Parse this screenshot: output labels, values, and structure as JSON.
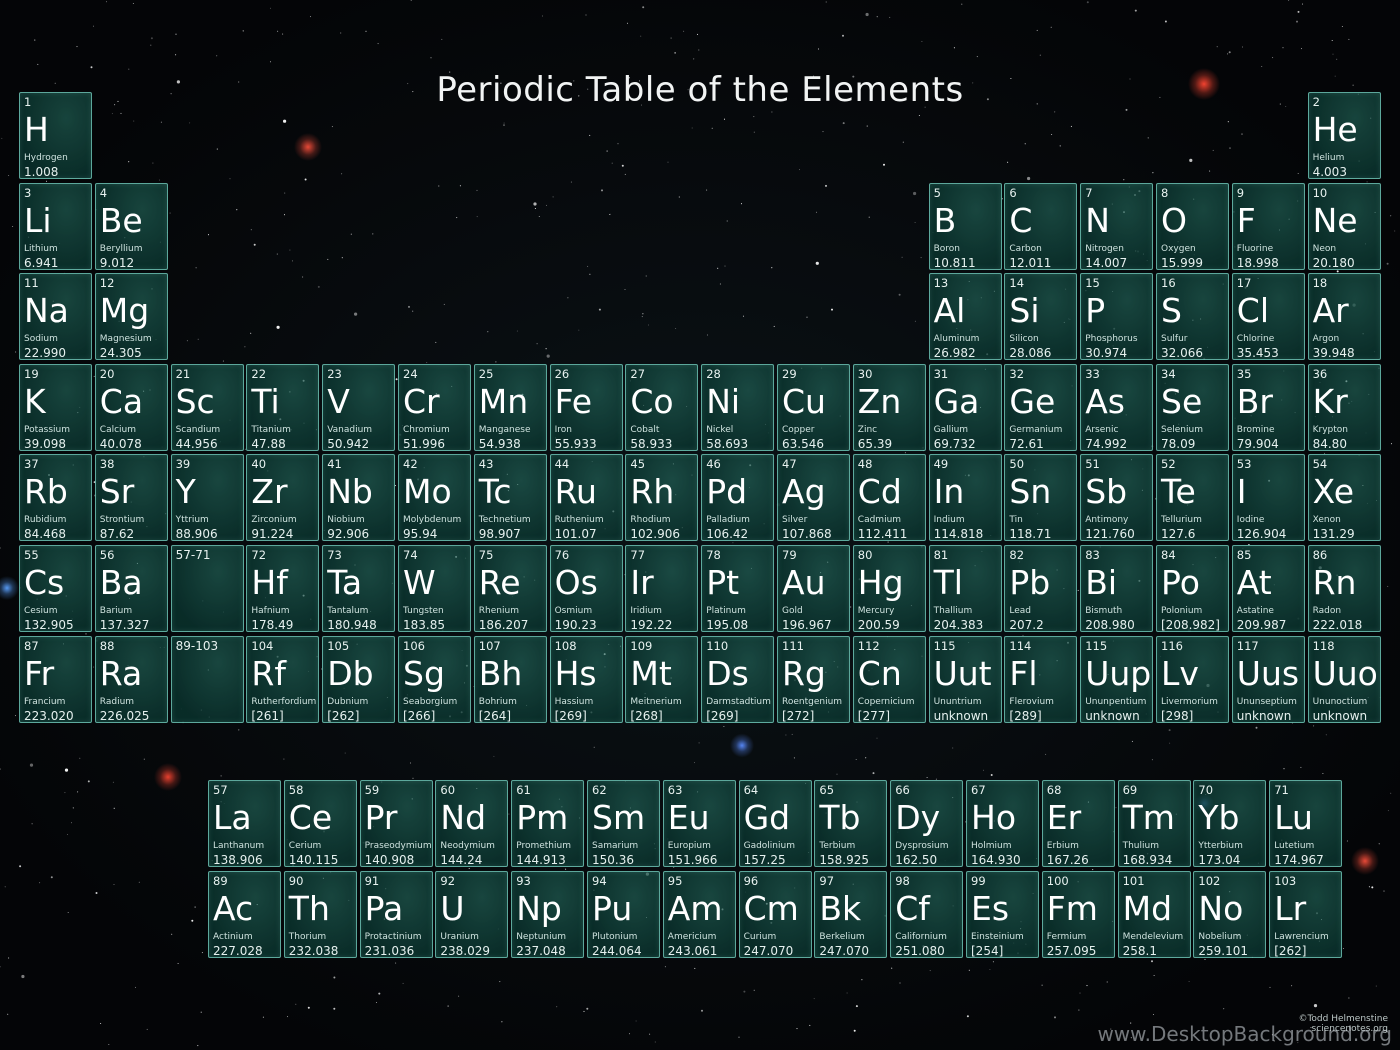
{
  "title": "Periodic Table of the Elements",
  "credit_line1": "©Todd Helmenstine",
  "credit_line2": "sciencenotes.org",
  "watermark": "www.DesktopBackground.org",
  "main_table": [
    [
      "1",
      "H",
      "Hydrogen",
      "1.008"
    ],
    null,
    null,
    null,
    null,
    null,
    null,
    null,
    null,
    null,
    null,
    null,
    null,
    null,
    null,
    null,
    null,
    [
      "2",
      "He",
      "Helium",
      "4.003"
    ],
    [
      "3",
      "Li",
      "Lithium",
      "6.941"
    ],
    [
      "4",
      "Be",
      "Beryllium",
      "9.012"
    ],
    null,
    null,
    null,
    null,
    null,
    null,
    null,
    null,
    null,
    null,
    [
      "5",
      "B",
      "Boron",
      "10.811"
    ],
    [
      "6",
      "C",
      "Carbon",
      "12.011"
    ],
    [
      "7",
      "N",
      "Nitrogen",
      "14.007"
    ],
    [
      "8",
      "O",
      "Oxygen",
      "15.999"
    ],
    [
      "9",
      "F",
      "Fluorine",
      "18.998"
    ],
    [
      "10",
      "Ne",
      "Neon",
      "20.180"
    ],
    [
      "11",
      "Na",
      "Sodium",
      "22.990"
    ],
    [
      "12",
      "Mg",
      "Magnesium",
      "24.305"
    ],
    null,
    null,
    null,
    null,
    null,
    null,
    null,
    null,
    null,
    null,
    [
      "13",
      "Al",
      "Aluminum",
      "26.982"
    ],
    [
      "14",
      "Si",
      "Silicon",
      "28.086"
    ],
    [
      "15",
      "P",
      "Phosphorus",
      "30.974"
    ],
    [
      "16",
      "S",
      "Sulfur",
      "32.066"
    ],
    [
      "17",
      "Cl",
      "Chlorine",
      "35.453"
    ],
    [
      "18",
      "Ar",
      "Argon",
      "39.948"
    ],
    [
      "19",
      "K",
      "Potassium",
      "39.098"
    ],
    [
      "20",
      "Ca",
      "Calcium",
      "40.078"
    ],
    [
      "21",
      "Sc",
      "Scandium",
      "44.956"
    ],
    [
      "22",
      "Ti",
      "Titanium",
      "47.88"
    ],
    [
      "23",
      "V",
      "Vanadium",
      "50.942"
    ],
    [
      "24",
      "Cr",
      "Chromium",
      "51.996"
    ],
    [
      "25",
      "Mn",
      "Manganese",
      "54.938"
    ],
    [
      "26",
      "Fe",
      "Iron",
      "55.933"
    ],
    [
      "27",
      "Co",
      "Cobalt",
      "58.933"
    ],
    [
      "28",
      "Ni",
      "Nickel",
      "58.693"
    ],
    [
      "29",
      "Cu",
      "Copper",
      "63.546"
    ],
    [
      "30",
      "Zn",
      "Zinc",
      "65.39"
    ],
    [
      "31",
      "Ga",
      "Gallium",
      "69.732"
    ],
    [
      "32",
      "Ge",
      "Germanium",
      "72.61"
    ],
    [
      "33",
      "As",
      "Arsenic",
      "74.992"
    ],
    [
      "34",
      "Se",
      "Selenium",
      "78.09"
    ],
    [
      "35",
      "Br",
      "Bromine",
      "79.904"
    ],
    [
      "36",
      "Kr",
      "Krypton",
      "84.80"
    ],
    [
      "37",
      "Rb",
      "Rubidium",
      "84.468"
    ],
    [
      "38",
      "Sr",
      "Strontium",
      "87.62"
    ],
    [
      "39",
      "Y",
      "Yttrium",
      "88.906"
    ],
    [
      "40",
      "Zr",
      "Zirconium",
      "91.224"
    ],
    [
      "41",
      "Nb",
      "Niobium",
      "92.906"
    ],
    [
      "42",
      "Mo",
      "Molybdenum",
      "95.94"
    ],
    [
      "43",
      "Tc",
      "Technetium",
      "98.907"
    ],
    [
      "44",
      "Ru",
      "Ruthenium",
      "101.07"
    ],
    [
      "45",
      "Rh",
      "Rhodium",
      "102.906"
    ],
    [
      "46",
      "Pd",
      "Palladium",
      "106.42"
    ],
    [
      "47",
      "Ag",
      "Silver",
      "107.868"
    ],
    [
      "48",
      "Cd",
      "Cadmium",
      "112.411"
    ],
    [
      "49",
      "In",
      "Indium",
      "114.818"
    ],
    [
      "50",
      "Sn",
      "Tin",
      "118.71"
    ],
    [
      "51",
      "Sb",
      "Antimony",
      "121.760"
    ],
    [
      "52",
      "Te",
      "Tellurium",
      "127.6"
    ],
    [
      "53",
      "I",
      "Iodine",
      "126.904"
    ],
    [
      "54",
      "Xe",
      "Xenon",
      "131.29"
    ],
    [
      "55",
      "Cs",
      "Cesium",
      "132.905"
    ],
    [
      "56",
      "Ba",
      "Barium",
      "137.327"
    ],
    [
      "57-71",
      "",
      "",
      ""
    ],
    [
      "72",
      "Hf",
      "Hafnium",
      "178.49"
    ],
    [
      "73",
      "Ta",
      "Tantalum",
      "180.948"
    ],
    [
      "74",
      "W",
      "Tungsten",
      "183.85"
    ],
    [
      "75",
      "Re",
      "Rhenium",
      "186.207"
    ],
    [
      "76",
      "Os",
      "Osmium",
      "190.23"
    ],
    [
      "77",
      "Ir",
      "Iridium",
      "192.22"
    ],
    [
      "78",
      "Pt",
      "Platinum",
      "195.08"
    ],
    [
      "79",
      "Au",
      "Gold",
      "196.967"
    ],
    [
      "80",
      "Hg",
      "Mercury",
      "200.59"
    ],
    [
      "81",
      "Tl",
      "Thallium",
      "204.383"
    ],
    [
      "82",
      "Pb",
      "Lead",
      "207.2"
    ],
    [
      "83",
      "Bi",
      "Bismuth",
      "208.980"
    ],
    [
      "84",
      "Po",
      "Polonium",
      "[208.982]"
    ],
    [
      "85",
      "At",
      "Astatine",
      "209.987"
    ],
    [
      "86",
      "Rn",
      "Radon",
      "222.018"
    ],
    [
      "87",
      "Fr",
      "Francium",
      "223.020"
    ],
    [
      "88",
      "Ra",
      "Radium",
      "226.025"
    ],
    [
      "89-103",
      "",
      "",
      ""
    ],
    [
      "104",
      "Rf",
      "Rutherfordium",
      "[261]"
    ],
    [
      "105",
      "Db",
      "Dubnium",
      "[262]"
    ],
    [
      "106",
      "Sg",
      "Seaborgium",
      "[266]"
    ],
    [
      "107",
      "Bh",
      "Bohrium",
      "[264]"
    ],
    [
      "108",
      "Hs",
      "Hassium",
      "[269]"
    ],
    [
      "109",
      "Mt",
      "Meitnerium",
      "[268]"
    ],
    [
      "110",
      "Ds",
      "Darmstadtium",
      "[269]"
    ],
    [
      "111",
      "Rg",
      "Roentgenium",
      "[272]"
    ],
    [
      "112",
      "Cn",
      "Copernicium",
      "[277]"
    ],
    [
      "115",
      "Uut",
      "Ununtrium",
      "unknown"
    ],
    [
      "114",
      "Fl",
      "Flerovium",
      "[289]"
    ],
    [
      "115",
      "Uup",
      "Ununpentium",
      "unknown"
    ],
    [
      "116",
      "Lv",
      "Livermorium",
      "[298]"
    ],
    [
      "117",
      "Uus",
      "Ununseptium",
      "unknown"
    ],
    [
      "118",
      "Uuo",
      "Ununoctium",
      "unknown"
    ]
  ],
  "lanthanides": [
    [
      "57",
      "La",
      "Lanthanum",
      "138.906"
    ],
    [
      "58",
      "Ce",
      "Cerium",
      "140.115"
    ],
    [
      "59",
      "Pr",
      "Praseodymium",
      "140.908"
    ],
    [
      "60",
      "Nd",
      "Neodymium",
      "144.24"
    ],
    [
      "61",
      "Pm",
      "Promethium",
      "144.913"
    ],
    [
      "62",
      "Sm",
      "Samarium",
      "150.36"
    ],
    [
      "63",
      "Eu",
      "Europium",
      "151.966"
    ],
    [
      "64",
      "Gd",
      "Gadolinium",
      "157.25"
    ],
    [
      "65",
      "Tb",
      "Terbium",
      "158.925"
    ],
    [
      "66",
      "Dy",
      "Dysprosium",
      "162.50"
    ],
    [
      "67",
      "Ho",
      "Holmium",
      "164.930"
    ],
    [
      "68",
      "Er",
      "Erbium",
      "167.26"
    ],
    [
      "69",
      "Tm",
      "Thulium",
      "168.934"
    ],
    [
      "70",
      "Yb",
      "Ytterbium",
      "173.04"
    ],
    [
      "71",
      "Lu",
      "Lutetium",
      "174.967"
    ]
  ],
  "actinides": [
    [
      "89",
      "Ac",
      "Actinium",
      "227.028"
    ],
    [
      "90",
      "Th",
      "Thorium",
      "232.038"
    ],
    [
      "91",
      "Pa",
      "Protactinium",
      "231.036"
    ],
    [
      "92",
      "U",
      "Uranium",
      "238.029"
    ],
    [
      "93",
      "Np",
      "Neptunium",
      "237.048"
    ],
    [
      "94",
      "Pu",
      "Plutonium",
      "244.064"
    ],
    [
      "95",
      "Am",
      "Americium",
      "243.061"
    ],
    [
      "96",
      "Cm",
      "Curium",
      "247.070"
    ],
    [
      "97",
      "Bk",
      "Berkelium",
      "247.070"
    ],
    [
      "98",
      "Cf",
      "Californium",
      "251.080"
    ],
    [
      "99",
      "Es",
      "Einsteinium",
      "[254]"
    ],
    [
      "100",
      "Fm",
      "Fermium",
      "257.095"
    ],
    [
      "101",
      "Md",
      "Mendelevium",
      "258.1"
    ],
    [
      "102",
      "No",
      "Nobelium",
      "259.101"
    ],
    [
      "103",
      "Lr",
      "Lawrencium",
      "[262]"
    ]
  ]
}
